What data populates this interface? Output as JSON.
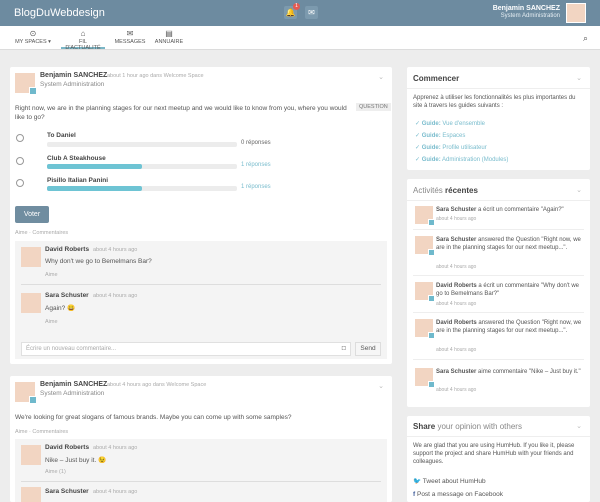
{
  "topbar": {
    "brand": "BlogDuWebdesign",
    "notif_count": "1",
    "user_name": "Benjamin SANCHEZ",
    "user_role": "System Administration"
  },
  "nav": {
    "items": [
      {
        "label": "MY SPACES ▾",
        "icon": "dot-circle-icon"
      },
      {
        "label": "FIL D'ACTUALITÉ",
        "icon": "home-icon"
      },
      {
        "label": "MESSAGES",
        "icon": "envelope-icon"
      },
      {
        "label": "ANNUAIRE",
        "icon": "book-icon"
      }
    ]
  },
  "post1": {
    "author": "Benjamin SANCHEZ",
    "meta": "about 1 hour ago dans Welcome Space",
    "role": "System Administration",
    "question": "Right now, we are in the planning stages for our next meetup and we would like to know from you, where you would like to go?",
    "badge": "QUESTION",
    "options": [
      {
        "label": "To Daniel",
        "votes": "0 réponses",
        "fill": 0.0
      },
      {
        "label": "Club A Steakhouse",
        "votes": "1 réponses",
        "fill": 0.5
      },
      {
        "label": "Pisillo Italian Panini",
        "votes": "1 réponses",
        "fill": 0.5
      }
    ],
    "vote_label": "Voter",
    "actions": "Aime · Commentaires",
    "comments": [
      {
        "author": "David Roberts",
        "meta": "about 4 hours ago",
        "text": "Why don't we go to Bemelmans Bar?",
        "like": "Aime"
      },
      {
        "author": "Sara Schuster",
        "meta": "about 4 hours ago",
        "text": "Again? 😀",
        "like": "Aime"
      }
    ],
    "comment_placeholder": "Écrire un nouveau commentaire...",
    "send_label": "Send"
  },
  "post2": {
    "author": "Benjamin SANCHEZ",
    "meta": "about 4 hours ago dans Welcome Space",
    "role": "System Administration",
    "text": "We're looking for great slogans of famous brands. Maybe you can come up with some samples?",
    "actions": "Aime · Commentaires",
    "comments": [
      {
        "author": "David Roberts",
        "meta": "about 4 hours ago",
        "text": "Nike – Just buy it. 😉",
        "like": "Aime (1)"
      },
      {
        "author": "Sara Schuster",
        "meta": "about 4 hours ago",
        "text": ""
      }
    ]
  },
  "sidebar": {
    "commencer": {
      "title": "Commencer",
      "intro": "Apprenez à utiliser les fonctionnalités les plus importantes du site à travers les guides suivants :",
      "guides": [
        {
          "prefix": "Guide:",
          "label": "Vue d'ensemble"
        },
        {
          "prefix": "Guide:",
          "label": "Espaces"
        },
        {
          "prefix": "Guide:",
          "label": "Profile utilisateur"
        },
        {
          "prefix": "Guide:",
          "label": "Administration (Modules)"
        }
      ]
    },
    "activity": {
      "title_light": "Activités",
      "title_bold": "récentes",
      "items": [
        {
          "actor": "Sara Schuster",
          "text": "a écrit un commentaire \"Again?\"",
          "time": "about 4 hours ago"
        },
        {
          "actor": "Sara Schuster",
          "text": "answered the Question \"Right now, we are in the planning stages for our next meetup...\".",
          "time": "about 4 hours ago"
        },
        {
          "actor": "David Roberts",
          "text": "a écrit un commentaire \"Why don't we go to Bemelmans Bar?\"",
          "time": "about 4 hours ago"
        },
        {
          "actor": "David Roberts",
          "text": "answered the Question \"Right now, we are in the planning stages for our next meetup...\".",
          "time": "about 4 hours ago"
        },
        {
          "actor": "Sara Schuster",
          "text": "aime commentaire \"Nike – Just buy it.\"",
          "time": "about 4 hours ago"
        }
      ]
    },
    "share": {
      "title_bold": "Share",
      "title_light": "your opinion with others",
      "text": "We are glad that you are using HumHub. If you like it, please support the project and share HumHub with your friends and colleagues.",
      "twitter": "Tweet about HumHub",
      "facebook": "Post a message on Facebook"
    }
  }
}
